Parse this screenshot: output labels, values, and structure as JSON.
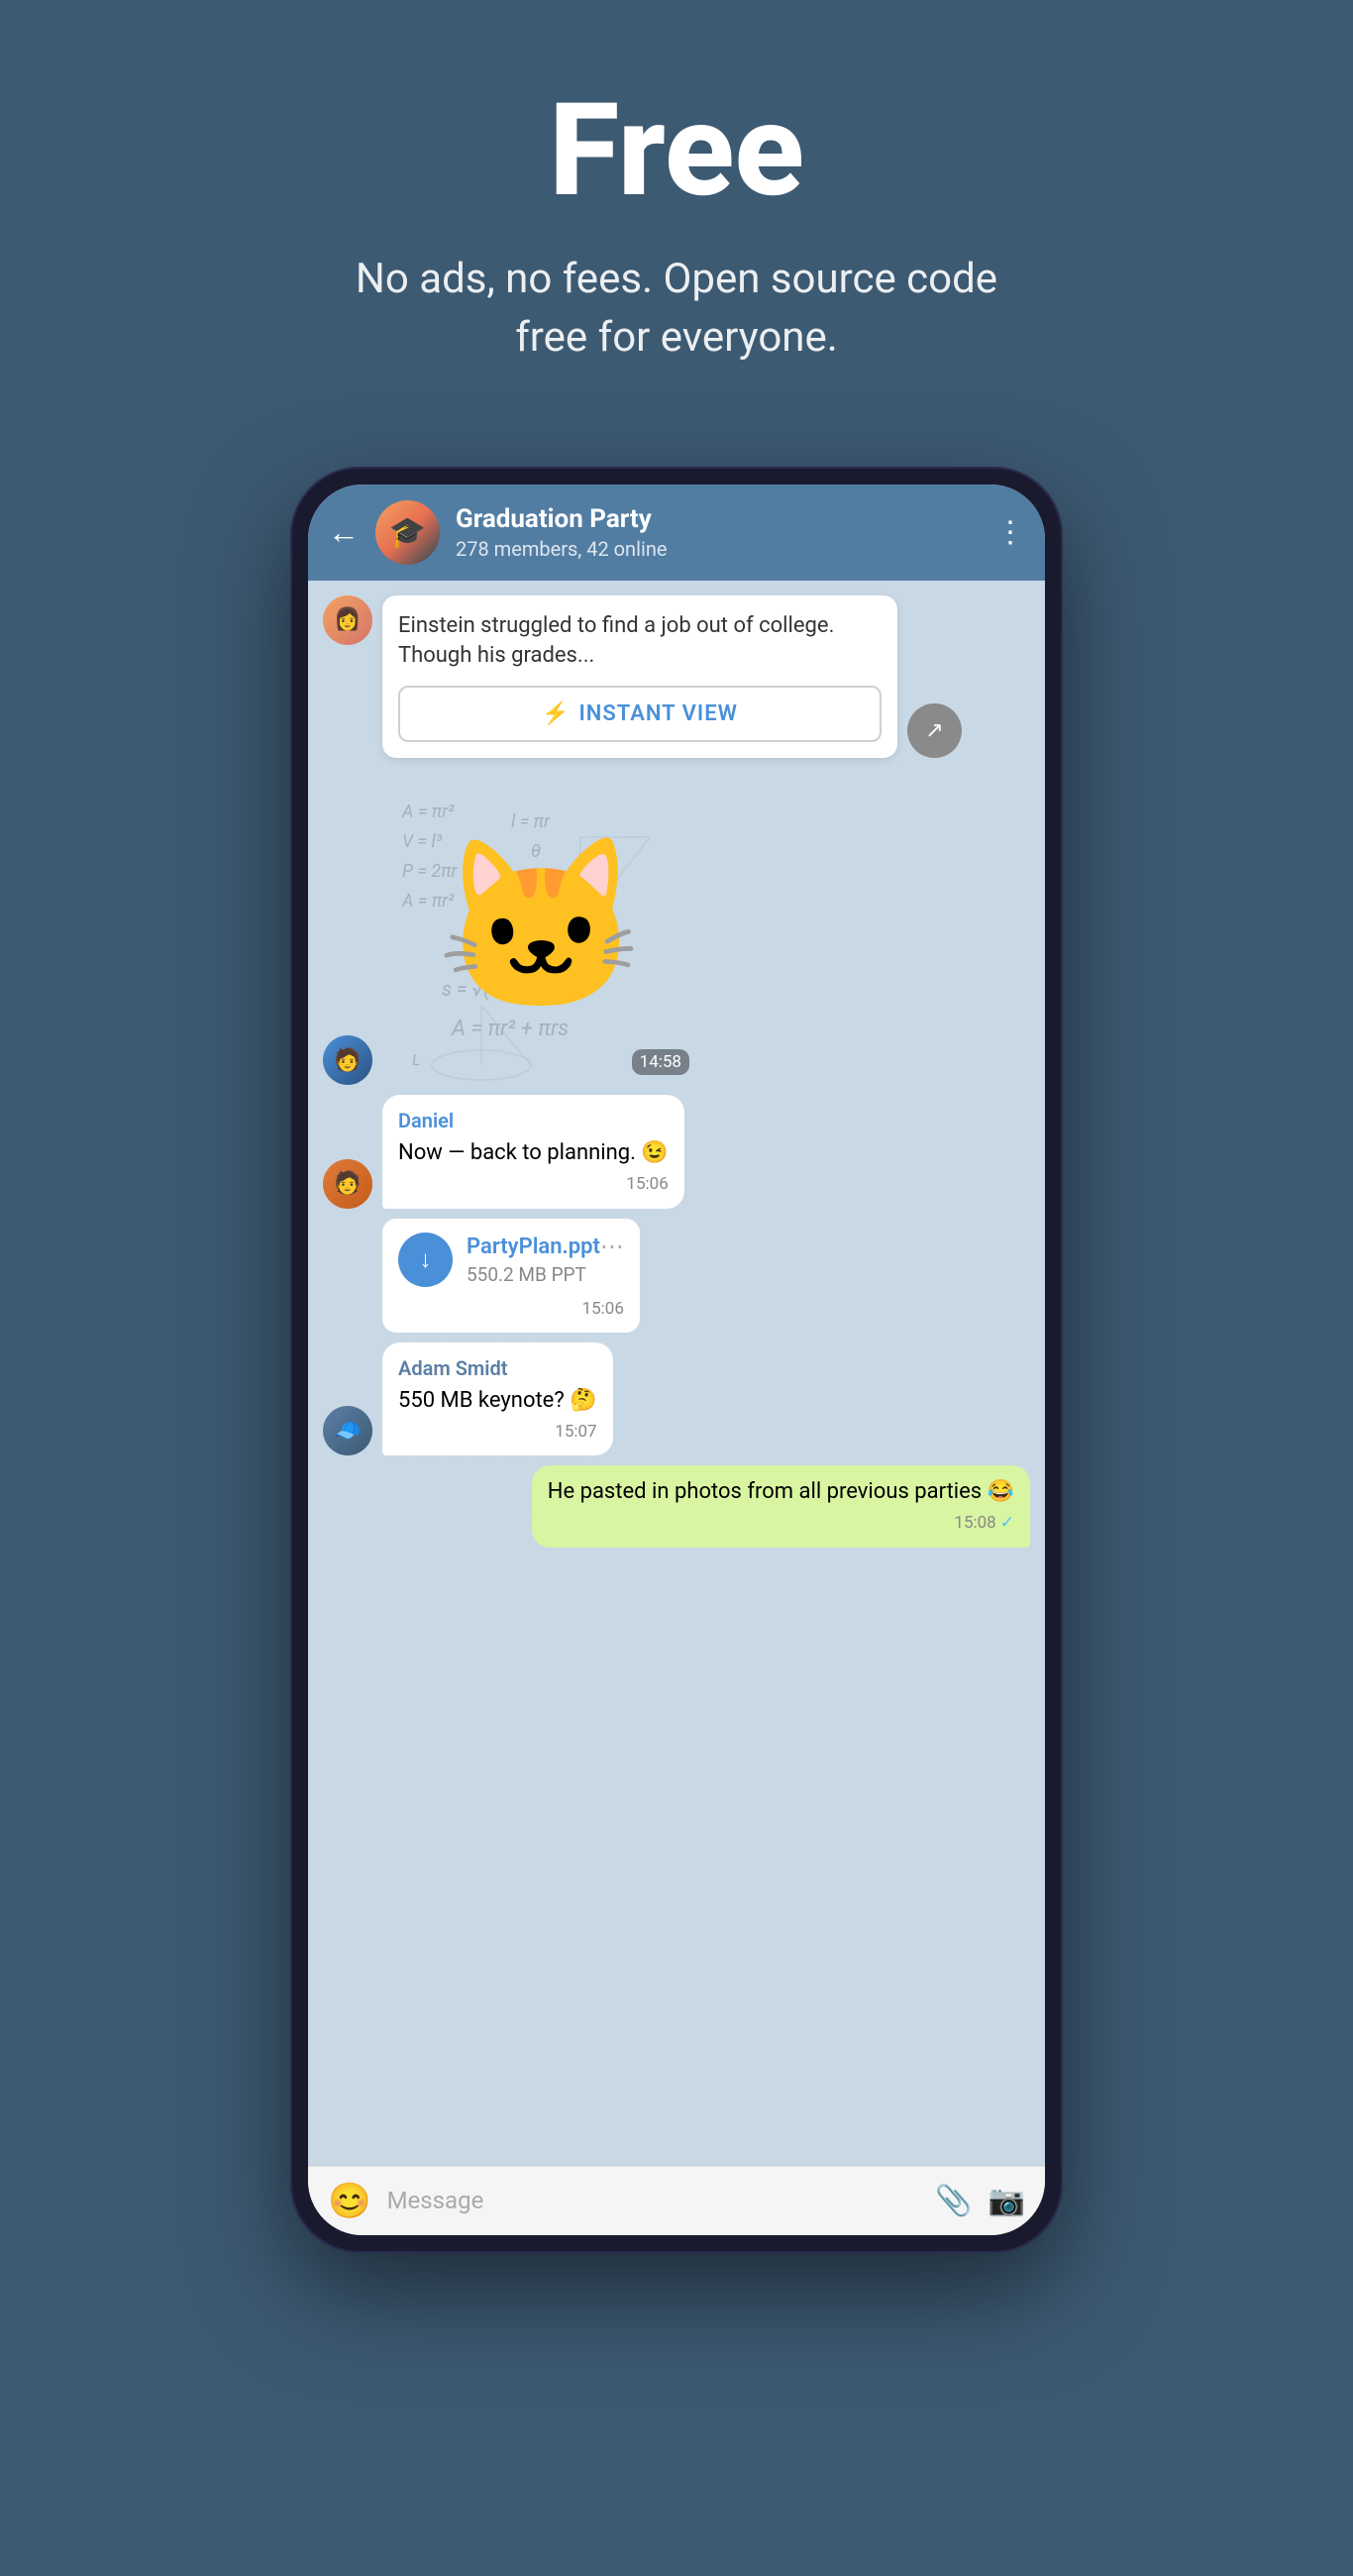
{
  "hero": {
    "title": "Free",
    "subtitle": "No ads, no fees. Open source code free for everyone."
  },
  "phone": {
    "header": {
      "group_name": "Graduation Party",
      "members_info": "278 members, 42 online",
      "back_label": "←",
      "menu_label": "⋮"
    },
    "messages": [
      {
        "id": "link-preview",
        "type": "link-preview",
        "sender_avatar": "girl",
        "text": "Einstein struggled to find a job out of college. Though his grades...",
        "instant_view_label": "INSTANT VIEW"
      },
      {
        "id": "sticker",
        "type": "sticker",
        "sender_avatar": "boy",
        "time": "14:58"
      },
      {
        "id": "daniel-msg",
        "type": "incoming",
        "sender": "Daniel",
        "sender_avatar": "guy",
        "text": "Now — back to planning. 😉",
        "time": "15:06"
      },
      {
        "id": "file-msg",
        "type": "file",
        "sender_avatar": "guy",
        "file_name": "PartyPlan.ppt",
        "file_size": "550.2 MB PPT",
        "time": "15:06"
      },
      {
        "id": "adam-msg",
        "type": "incoming",
        "sender": "Adam Smidt",
        "sender_avatar": "blue-hat",
        "text": "550 MB keynote? 🤔",
        "time": "15:07"
      },
      {
        "id": "outgoing-msg",
        "type": "outgoing",
        "text": "He pasted in photos from all previous parties 😂",
        "time": "15:08",
        "read": true
      }
    ],
    "input_bar": {
      "placeholder": "Message",
      "emoji_icon": "😊",
      "attachment_icon": "📎",
      "camera_icon": "📷"
    }
  }
}
